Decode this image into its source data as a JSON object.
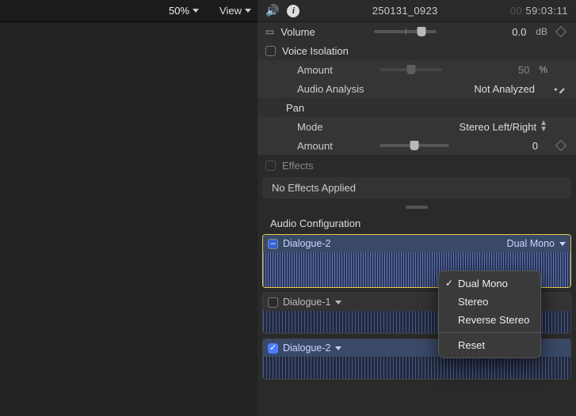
{
  "viewer": {
    "zoom": "50%",
    "view_menu": "View"
  },
  "inspector": {
    "title": "250131_0923",
    "timecode_dim": "00:",
    "timecode": "59:03:11",
    "volume": {
      "label": "Volume",
      "value": "0.0",
      "unit": "dB"
    },
    "voice_isolation": {
      "label": "Voice Isolation",
      "amount_label": "Amount",
      "amount_value": "50",
      "amount_unit": "%",
      "analysis_label": "Audio Analysis",
      "analysis_value": "Not Analyzed"
    },
    "pan": {
      "label": "Pan",
      "mode_label": "Mode",
      "mode_value": "Stereo Left/Right",
      "amount_label": "Amount",
      "amount_value": "0"
    },
    "effects": {
      "label": "Effects",
      "none": "No Effects Applied"
    },
    "audio_config": {
      "label": "Audio Configuration",
      "clips": [
        {
          "name": "Dialogue-2",
          "mode": "Dual Mono",
          "selected": true,
          "checked": false,
          "collapse": true
        },
        {
          "name": "Dialogue-1",
          "mode": "",
          "selected": false,
          "checked": false,
          "collapse": false
        },
        {
          "name": "Dialogue-2",
          "mode": "",
          "selected": false,
          "checked": true,
          "collapse": false
        }
      ],
      "mode_menu": {
        "items": [
          "Dual Mono",
          "Stereo",
          "Reverse Stereo"
        ],
        "reset": "Reset",
        "checked_index": 0
      }
    }
  }
}
